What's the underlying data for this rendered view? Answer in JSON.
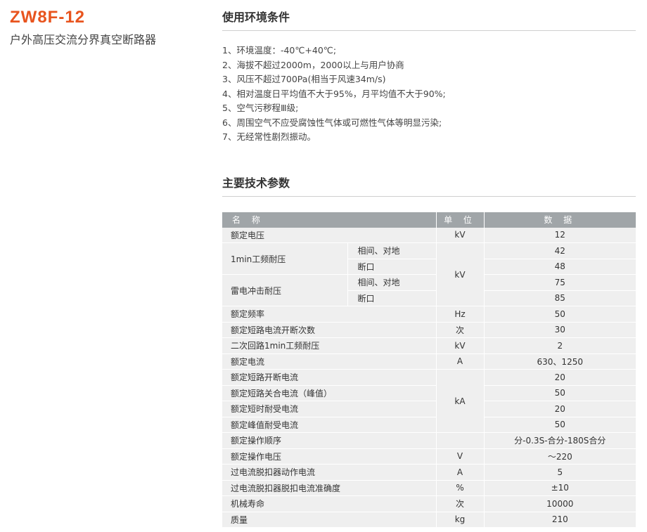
{
  "product": {
    "model": "ZW8F-12",
    "subtitle": "户外高压交流分界真空断路器"
  },
  "conditions": {
    "title": "使用环境条件",
    "items": [
      "1、环境温度：-40℃+40℃;",
      "2、海拔不超过2000m，2000以上与用户协商",
      "3、风压不超过700Pa(相当于风速34m/s)",
      "4、相对温度日平均值不大于95%，月平均值不大于90%;",
      "5、空气污秽程Ⅲ级;",
      "6、周围空气不应受腐蚀性气体或可燃性气体等明显污染;",
      "7、无经常性剧烈振动。"
    ]
  },
  "params": {
    "title": "主要技术参数",
    "headers": {
      "name": "名 称",
      "unit": "单 位",
      "value": "数 据"
    },
    "rows": {
      "r1": {
        "name": "额定电压",
        "unit": "kV",
        "value": "12"
      },
      "r2": {
        "name": "1min工频耐压",
        "sub1": "相间、对地",
        "sub2": "断口",
        "unit": "kV",
        "v1": "42",
        "v2": "48"
      },
      "r3": {
        "name": "雷电冲击耐压",
        "sub1": "相间、对地",
        "sub2": "断口",
        "v1": "75",
        "v2": "85"
      },
      "r4": {
        "name": "额定频率",
        "unit": "Hz",
        "value": "50"
      },
      "r5": {
        "name": "额定短路电流开断次数",
        "unit": "次",
        "value": "30"
      },
      "r6": {
        "name": "二次回路1min工频耐压",
        "unit": "kV",
        "value": "2"
      },
      "r7": {
        "name": "额定电流",
        "unit": "A",
        "value": "630、1250"
      },
      "r8": {
        "name": "额定短路开断电流",
        "unit": "kA",
        "value": "20"
      },
      "r9": {
        "name": "额定短路关合电流（峰值）",
        "value": "50"
      },
      "r10": {
        "name": "额定短时耐受电流",
        "value": "20"
      },
      "r11": {
        "name": "额定峰值耐受电流",
        "value": "50"
      },
      "r12": {
        "name": "额定操作顺序",
        "unit": "",
        "value": "分-0.3S-合分-180S合分"
      },
      "r13": {
        "name": "额定操作电压",
        "unit": "V",
        "value": "～220"
      },
      "r14": {
        "name": "过电流脱扣器动作电流",
        "unit": "A",
        "value": "5"
      },
      "r15": {
        "name": "过电流脱扣器脱扣电流准确度",
        "unit": "%",
        "value": "±10"
      },
      "r16": {
        "name": "机械寿命",
        "unit": "次",
        "value": "10000"
      },
      "r17": {
        "name": "质量",
        "unit": "kg",
        "value": "210"
      }
    }
  }
}
